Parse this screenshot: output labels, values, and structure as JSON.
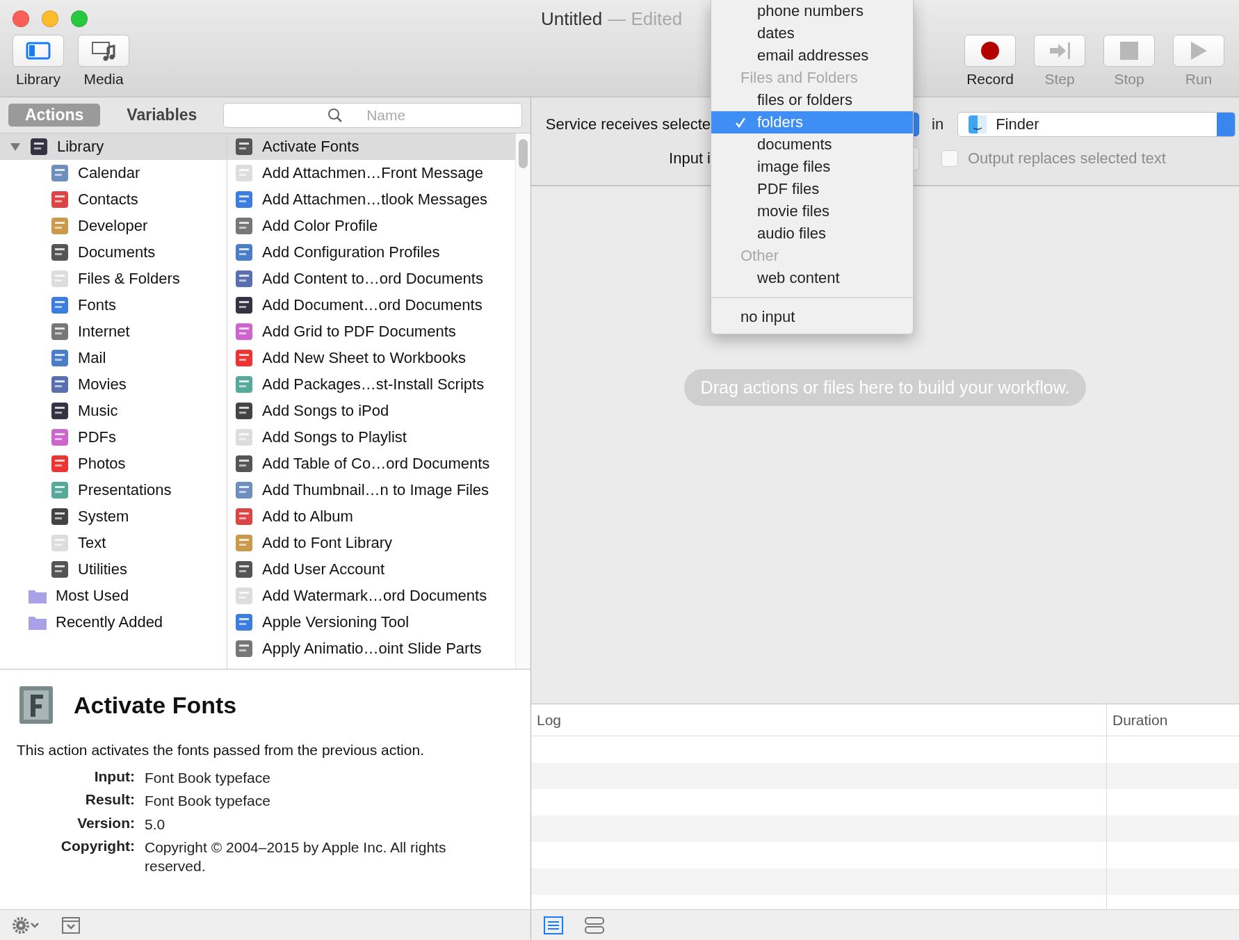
{
  "window": {
    "title": "Untitled",
    "edited": "— Edited"
  },
  "toolbar": {
    "left": [
      {
        "label": "Library",
        "disabled": false
      },
      {
        "label": "Media",
        "disabled": false
      }
    ],
    "right": [
      {
        "label": "Record",
        "disabled": false
      },
      {
        "label": "Step",
        "disabled": true
      },
      {
        "label": "Stop",
        "disabled": true
      },
      {
        "label": "Run",
        "disabled": true
      }
    ]
  },
  "tabs": [
    {
      "label": "Actions",
      "selected": true
    },
    {
      "label": "Variables",
      "selected": false
    }
  ],
  "search": {
    "placeholder": "Name"
  },
  "library": [
    {
      "label": "Library",
      "selected": true,
      "expanded": true,
      "children": [
        {
          "label": "Calendar",
          "selected": false
        },
        {
          "label": "Contacts",
          "selected": false
        },
        {
          "label": "Developer",
          "selected": false
        },
        {
          "label": "Documents",
          "selected": false
        },
        {
          "label": "Files & Folders",
          "selected": false
        },
        {
          "label": "Fonts",
          "selected": false
        },
        {
          "label": "Internet",
          "selected": false
        },
        {
          "label": "Mail",
          "selected": false
        },
        {
          "label": "Movies",
          "selected": false
        },
        {
          "label": "Music",
          "selected": false
        },
        {
          "label": "PDFs",
          "selected": false
        },
        {
          "label": "Photos",
          "selected": false
        },
        {
          "label": "Presentations",
          "selected": false
        },
        {
          "label": "System",
          "selected": false
        },
        {
          "label": "Text",
          "selected": false
        },
        {
          "label": "Utilities",
          "selected": false
        }
      ]
    },
    {
      "label": "Most Used",
      "selected": false
    },
    {
      "label": "Recently Added",
      "selected": false
    }
  ],
  "actions": [
    {
      "label": "Activate Fonts",
      "selected": true
    },
    {
      "label": "Add Attachmen…Front Message",
      "selected": false
    },
    {
      "label": "Add Attachmen…tlook Messages",
      "selected": false
    },
    {
      "label": "Add Color Profile",
      "selected": false
    },
    {
      "label": "Add Configuration Profiles",
      "selected": false
    },
    {
      "label": "Add Content to…ord Documents",
      "selected": false
    },
    {
      "label": "Add Document…ord Documents",
      "selected": false
    },
    {
      "label": "Add Grid to PDF Documents",
      "selected": false
    },
    {
      "label": "Add New Sheet to Workbooks",
      "selected": false
    },
    {
      "label": "Add Packages…st-Install Scripts",
      "selected": false
    },
    {
      "label": "Add Songs to iPod",
      "selected": false
    },
    {
      "label": "Add Songs to Playlist",
      "selected": false
    },
    {
      "label": "Add Table of Co…ord Documents",
      "selected": false
    },
    {
      "label": "Add Thumbnail…n to Image Files",
      "selected": false
    },
    {
      "label": "Add to Album",
      "selected": false
    },
    {
      "label": "Add to Font Library",
      "selected": false
    },
    {
      "label": "Add User Account",
      "selected": false
    },
    {
      "label": "Add Watermark…ord Documents",
      "selected": false
    },
    {
      "label": "Apple Versioning Tool",
      "selected": false
    },
    {
      "label": "Apply Animatio…oint Slide Parts",
      "selected": false
    }
  ],
  "description": {
    "title": "Activate Fonts",
    "text": "This action activates the fonts passed from the previous action.",
    "fields": [
      {
        "label": "Input:",
        "value": "Font Book typeface"
      },
      {
        "label": "Result:",
        "value": "Font Book typeface"
      },
      {
        "label": "Version:",
        "value": "5.0"
      },
      {
        "label": "Copyright:",
        "value": "Copyright © 2004–2015 by Apple Inc. All rights reserved."
      }
    ]
  },
  "service": {
    "receives_label": "Service receives selecte",
    "in_label": "in",
    "application": "Finder",
    "input_label": "Input i",
    "output_option": {
      "label": "Output replaces selected text",
      "checked": false,
      "disabled": true
    }
  },
  "workflow": {
    "placeholder": "Drag actions or files here to build your workflow."
  },
  "log": {
    "columns": [
      "Log",
      "Duration"
    ]
  },
  "bottom_bar": {
    "view_modes": [
      {
        "kind": "list",
        "selected": true
      },
      {
        "kind": "split",
        "selected": false
      }
    ]
  },
  "menu": [
    {
      "kind": "option",
      "label": "phone numbers",
      "selected": false
    },
    {
      "kind": "option",
      "label": "dates",
      "selected": false
    },
    {
      "kind": "option",
      "label": "email addresses",
      "selected": false
    },
    {
      "kind": "header",
      "label": "Files and Folders"
    },
    {
      "kind": "option",
      "label": "files or folders",
      "selected": false
    },
    {
      "kind": "option",
      "label": "folders",
      "selected": true
    },
    {
      "kind": "option",
      "label": "documents",
      "selected": false
    },
    {
      "kind": "option",
      "label": "image files",
      "selected": false
    },
    {
      "kind": "option",
      "label": "PDF files",
      "selected": false
    },
    {
      "kind": "option",
      "label": "movie files",
      "selected": false
    },
    {
      "kind": "option",
      "label": "audio files",
      "selected": false
    },
    {
      "kind": "header",
      "label": "Other"
    },
    {
      "kind": "option",
      "label": "web content",
      "selected": false
    },
    {
      "kind": "separator"
    },
    {
      "kind": "top",
      "label": "no input",
      "selected": false
    }
  ]
}
